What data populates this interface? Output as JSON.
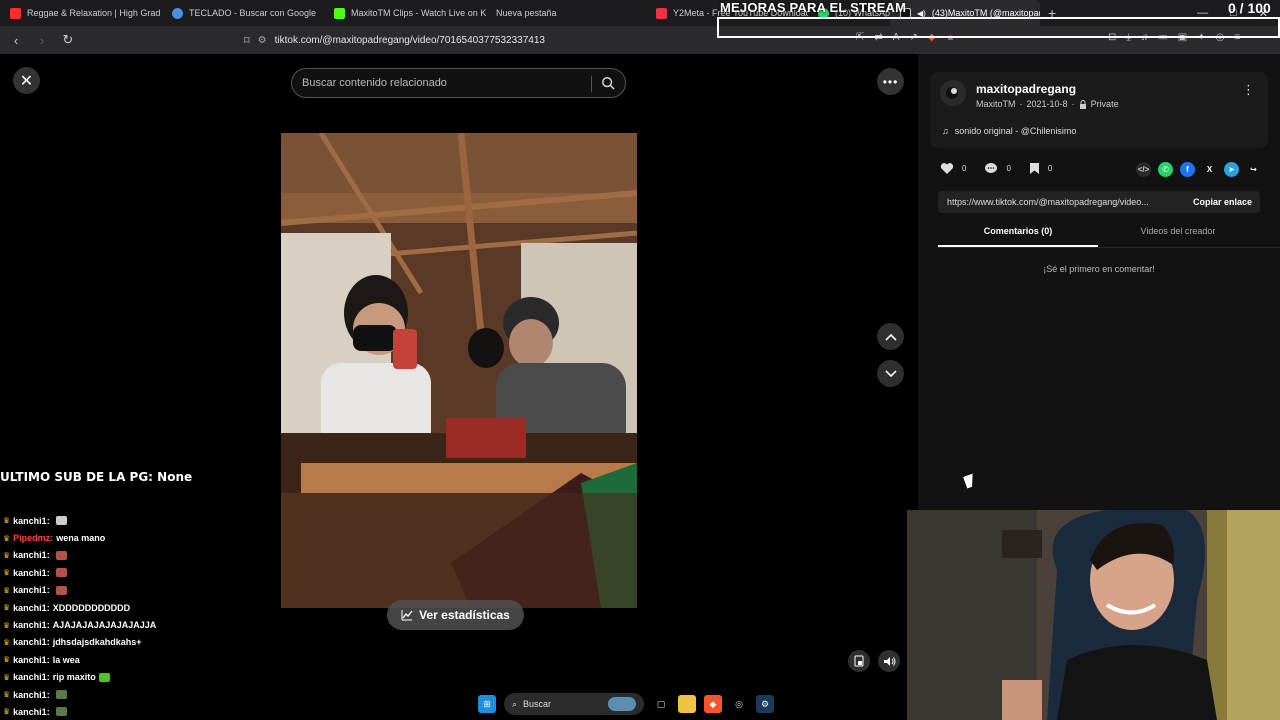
{
  "browser": {
    "tabs": [
      {
        "label": "Reggae & Relaxation | High Grad",
        "color": "#ff2d2d"
      },
      {
        "label": "TECLADO - Buscar con Google",
        "color": "#4a90e2"
      },
      {
        "label": "MaxitoTM Clips - Watch Live on Kick",
        "color": "#53fc18"
      },
      {
        "label": "Nueva pestaña",
        "color": "#333333"
      },
      {
        "label": "Y2Meta - Free YouTube Download",
        "color": "#e8334a"
      },
      {
        "label": "(10) WhatsApp",
        "color": "#25d366"
      },
      {
        "label": "(43)MaxitoTM (@maxitopad",
        "color": "#ffffff",
        "close": "×"
      }
    ],
    "new_tab": "+",
    "url": "tiktok.com/@maxitopadregang/video/7016540377532337413"
  },
  "overlay": {
    "title": "MEJORAS PARA EL STREAM",
    "counter": "0 / 100",
    "sub_label": "ULTIMO SUB DE LA PG: None"
  },
  "search": {
    "placeholder": "Buscar contenido relacionado"
  },
  "stats_button": "Ver estadísticas",
  "post": {
    "username": "maxitopadregang",
    "author": "MaxitoTM",
    "date": "2021-10-8",
    "dot": "·",
    "privacy": "Private",
    "sound": "sonido original - @Chilenisimo",
    "likes": "0",
    "comments": "0",
    "saves": "0",
    "link": "https://www.tiktok.com/@maxitopadregang/video...",
    "copy_label": "Copiar enlace",
    "tab_comments": "Comentarios (0)",
    "tab_videos": "Videos del creador",
    "empty_comments": "¡Sé el primero en comentar!"
  },
  "chat": [
    {
      "user": "kanchi1:",
      "text": "",
      "emote": "#cccccc",
      "user_color": "#ffffff"
    },
    {
      "user": "Pipedmz:",
      "text": "wena mano",
      "emote": "",
      "user_color": "#ff4444"
    },
    {
      "user": "kanchi1:",
      "text": "",
      "emote": "#b5524a",
      "user_color": "#ffffff"
    },
    {
      "user": "kanchi1:",
      "text": "",
      "emote": "#b5524a",
      "user_color": "#ffffff"
    },
    {
      "user": "kanchi1:",
      "text": "",
      "emote": "#b5524a",
      "user_color": "#ffffff"
    },
    {
      "user": "kanchi1:",
      "text": "XDDDDDDDDDDD",
      "emote": "",
      "user_color": "#ffffff"
    },
    {
      "user": "kanchi1:",
      "text": "AJAJAJAJAJAJAJAJJA",
      "emote": "",
      "user_color": "#ffffff"
    },
    {
      "user": "kanchi1:",
      "text": "jdhsdajsdkahdkahs+",
      "emote": "",
      "user_color": "#ffffff"
    },
    {
      "user": "kanchi1:",
      "text": "la wea",
      "emote": "",
      "user_color": "#ffffff"
    },
    {
      "user": "kanchi1:",
      "text": "rip maxito",
      "emote": "#53c02a",
      "user_color": "#ffffff"
    },
    {
      "user": "kanchi1:",
      "text": "",
      "emote": "#5a7a4a",
      "user_color": "#ffffff"
    },
    {
      "user": "kanchi1:",
      "text": "",
      "emote": "#5a7a4a",
      "user_color": "#ffffff"
    }
  ],
  "taskbar": {
    "search": "Buscar"
  },
  "colors": {
    "bg": "#000000",
    "sidebar": "#121212",
    "card": "#1b1b1b",
    "whatsapp": "#25d366",
    "facebook": "#1877f2",
    "telegram": "#2aa3df"
  }
}
